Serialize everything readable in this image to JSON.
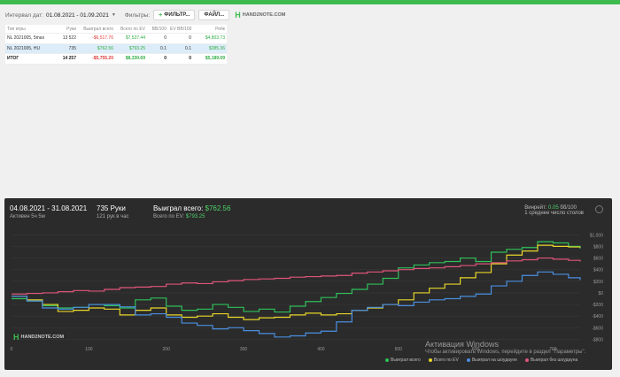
{
  "filters": {
    "interval_label": "Интервал дат:",
    "interval_value": "01.08.2021 - 01.09.2021",
    "filters_label": "Фильтры:",
    "filter_button": "ФИЛЬТР...",
    "file_button": "ФАЙЛ...",
    "logo_text": "HAND2NOTE.COM"
  },
  "table": {
    "headers": [
      "Тип игры",
      "Руки",
      "Выиграл всего",
      "Всего по EV",
      "BB/100",
      "EV BB/100",
      "Рейк"
    ],
    "rows": [
      {
        "game": "NL 2021005, 5max",
        "hands": "13 522",
        "won": "-$6,517.76",
        "ev": "$7,537.44",
        "bb": "0",
        "evbb": "0",
        "rake": "$4,803.73"
      },
      {
        "game": "NL 2021005, HU",
        "hands": "735",
        "won": "$762.56",
        "ev": "$793.25",
        "bb": "0.1",
        "evbb": "0.1",
        "rake": "$385.36"
      }
    ],
    "total": {
      "game": "ИТОГ",
      "hands": "14 257",
      "won": "-$5,755.20",
      "ev": "$8,330.69",
      "bb": "0",
      "evbb": "0",
      "rake": "$5,189.09"
    }
  },
  "chart_header": {
    "dates": "04.08.2021 - 31.08.2021",
    "active": "Активен 5ч 5м",
    "hands": "735 Руки",
    "per_hour": "121 рук в час",
    "won_label": "Выиграл всего:",
    "won_value": "$762.56",
    "ev_label": "Всего по EV:",
    "ev_value": "$793.25",
    "winrate_label": "Винрейт:",
    "winrate_value": "0.05",
    "winrate_unit": "бб/100",
    "tables": "1 среднее число столов",
    "logo_text": "HAND2NOTE.COM"
  },
  "watermark": {
    "title": "Активация Windows",
    "subtitle": "Чтобы активировать Windows, перейдите в раздел \"Параметры\"."
  },
  "chart_data": {
    "type": "line",
    "x_ticks": [
      0,
      100,
      200,
      300,
      400,
      500,
      600,
      700
    ],
    "y_ticks": [
      "$1,000",
      "$800",
      "$600",
      "$400",
      "$200",
      "$0",
      "-$200",
      "-$400",
      "-$600",
      "-$800"
    ],
    "xlim": [
      0,
      735
    ],
    "ylim": [
      -900,
      1050
    ],
    "series": [
      {
        "name": "Выиграл всего",
        "color": "#2fc05a",
        "x": [
          0,
          20,
          40,
          60,
          80,
          100,
          120,
          140,
          160,
          180,
          200,
          220,
          240,
          260,
          280,
          300,
          320,
          340,
          360,
          380,
          400,
          420,
          440,
          460,
          480,
          500,
          520,
          540,
          560,
          580,
          600,
          620,
          640,
          660,
          680,
          700,
          720,
          735
        ],
        "y": [
          -100,
          -140,
          -220,
          -260,
          -250,
          -200,
          -220,
          -260,
          -120,
          -90,
          -230,
          -300,
          -280,
          -200,
          -250,
          -320,
          -280,
          -330,
          -230,
          -150,
          -80,
          -10,
          60,
          150,
          250,
          430,
          480,
          520,
          540,
          600,
          540,
          700,
          750,
          780,
          880,
          860,
          800,
          762
        ]
      },
      {
        "name": "Всего по EV",
        "color": "#e8d62a",
        "x": [
          0,
          20,
          40,
          60,
          80,
          100,
          120,
          140,
          160,
          180,
          200,
          220,
          240,
          260,
          280,
          300,
          320,
          340,
          360,
          380,
          400,
          420,
          440,
          460,
          480,
          500,
          520,
          540,
          560,
          580,
          600,
          620,
          640,
          660,
          680,
          700,
          720,
          735
        ],
        "y": [
          -60,
          -120,
          -200,
          -320,
          -300,
          -260,
          -280,
          -380,
          -300,
          -260,
          -380,
          -420,
          -400,
          -360,
          -420,
          -460,
          -430,
          -420,
          -380,
          -350,
          -380,
          -360,
          -300,
          -260,
          -200,
          -120,
          0,
          80,
          150,
          260,
          350,
          500,
          650,
          720,
          820,
          800,
          790,
          793
        ]
      },
      {
        "name": "Выиграл на шоудауне",
        "color": "#4a8ee0",
        "x": [
          0,
          20,
          40,
          60,
          80,
          100,
          120,
          140,
          160,
          180,
          200,
          220,
          240,
          260,
          280,
          300,
          320,
          340,
          360,
          380,
          400,
          420,
          440,
          460,
          480,
          500,
          520,
          540,
          560,
          580,
          600,
          620,
          640,
          660,
          680,
          700,
          720,
          735
        ],
        "y": [
          -60,
          -140,
          -260,
          -280,
          -250,
          -200,
          -200,
          -240,
          -380,
          -360,
          -420,
          -520,
          -560,
          -620,
          -600,
          -650,
          -700,
          -760,
          -740,
          -690,
          -660,
          -500,
          -300,
          -250,
          -200,
          -220,
          -160,
          -120,
          -100,
          -60,
          -20,
          120,
          200,
          300,
          360,
          320,
          260,
          220
        ]
      },
      {
        "name": "Выиграл без шоудауна",
        "color": "#e0557a",
        "x": [
          0,
          20,
          40,
          60,
          80,
          100,
          120,
          140,
          160,
          180,
          200,
          220,
          240,
          260,
          280,
          300,
          320,
          340,
          360,
          380,
          400,
          420,
          440,
          460,
          480,
          500,
          520,
          540,
          560,
          580,
          600,
          620,
          640,
          660,
          680,
          700,
          720,
          735
        ],
        "y": [
          -20,
          -10,
          0,
          20,
          40,
          30,
          60,
          90,
          100,
          110,
          150,
          170,
          160,
          190,
          210,
          230,
          240,
          250,
          270,
          280,
          290,
          300,
          340,
          360,
          380,
          400,
          420,
          430,
          450,
          470,
          500,
          520,
          550,
          570,
          600,
          580,
          560,
          540
        ]
      }
    ]
  }
}
